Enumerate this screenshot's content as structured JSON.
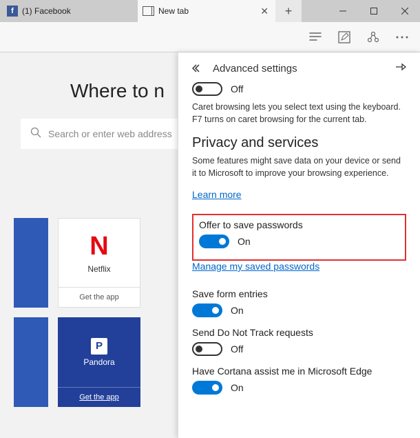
{
  "tabs": [
    {
      "title": "(1) Facebook"
    },
    {
      "title": "New tab"
    }
  ],
  "content": {
    "heading": "Where to n",
    "search_placeholder": "Search or enter web address"
  },
  "tiles": [
    {
      "name": "Netflix",
      "footer": "Get the app"
    },
    {
      "name": "Pandora",
      "footer": "Get the app"
    }
  ],
  "panel": {
    "title": "Advanced settings",
    "caret_toggle": "Off",
    "caret_desc": "Caret browsing lets you select text using the keyboard. F7 turns on caret browsing for the current tab.",
    "privacy_heading": "Privacy and services",
    "privacy_desc": "Some features might save data on your device or send it to Microsoft to improve your browsing experience.",
    "learn_more": "Learn more",
    "save_pw_label": "Offer to save passwords",
    "save_pw_toggle": "On",
    "manage_pw_link": "Manage my saved passwords",
    "form_label": "Save form entries",
    "form_toggle": "On",
    "dnt_label": "Send Do Not Track requests",
    "dnt_toggle": "Off",
    "cortana_label": "Have Cortana assist me in Microsoft Edge",
    "cortana_toggle": "On"
  }
}
